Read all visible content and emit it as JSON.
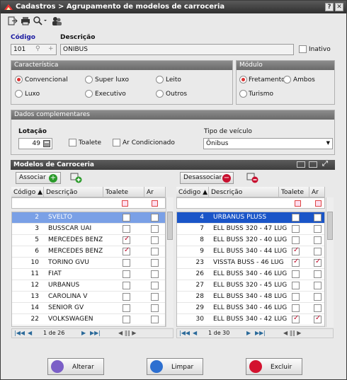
{
  "window": {
    "title": "Cadastros > Agrupamento de modelos de carroceria"
  },
  "form": {
    "codigo_label": "Código",
    "codigo_value": "101",
    "descricao_label": "Descrição",
    "descricao_value": "ONIBUS",
    "inativo_label": "Inativo"
  },
  "caracteristica": {
    "title": "Característica",
    "options": [
      "Convencional",
      "Super luxo",
      "Leito",
      "Luxo",
      "Executivo",
      "Outros"
    ],
    "selected": "Convencional"
  },
  "modulo": {
    "title": "Módulo",
    "options": [
      "Fretamento",
      "Ambos",
      "Turismo"
    ],
    "selected": "Fretamento"
  },
  "dados": {
    "title": "Dados complementares",
    "lotacao_label": "Lotação",
    "lotacao_value": "49",
    "toalete_label": "Toalete",
    "ar_label": "Ar Condicionado",
    "tipo_label": "Tipo de veículo",
    "tipo_value": "Ônibus"
  },
  "grid": {
    "title": "Modelos de Carroceria",
    "associar_label": "Associar",
    "desassociar_label": "Desassociar",
    "columns": {
      "codigo": "Código",
      "descricao": "Descrição",
      "toalete": "Toalete",
      "ar": "Ar"
    },
    "left_rows": [
      {
        "codigo": "2",
        "descricao": "SVELTO",
        "toalete": false,
        "ar": false
      },
      {
        "codigo": "3",
        "descricao": "BUSSCAR UAI",
        "toalete": false,
        "ar": false
      },
      {
        "codigo": "5",
        "descricao": "MERCEDES BENZ",
        "toalete": true,
        "ar": false
      },
      {
        "codigo": "6",
        "descricao": "MERCEDES BENZ",
        "toalete": true,
        "ar": false
      },
      {
        "codigo": "10",
        "descricao": "TORINO GVU",
        "toalete": false,
        "ar": false
      },
      {
        "codigo": "11",
        "descricao": "FIAT",
        "toalete": false,
        "ar": false
      },
      {
        "codigo": "12",
        "descricao": "URBANUS",
        "toalete": false,
        "ar": false
      },
      {
        "codigo": "13",
        "descricao": "CAROLINA V",
        "toalete": false,
        "ar": false
      },
      {
        "codigo": "14",
        "descricao": "SENIOR GV",
        "toalete": false,
        "ar": false
      },
      {
        "codigo": "22",
        "descricao": "VOLKSWAGEN",
        "toalete": false,
        "ar": false
      }
    ],
    "right_rows": [
      {
        "codigo": "4",
        "descricao": "URBANUS PLUSS",
        "toalete": false,
        "ar": false
      },
      {
        "codigo": "7",
        "descricao": "ELL BUSS 320 - 47 LUG",
        "toalete": false,
        "ar": false
      },
      {
        "codigo": "8",
        "descricao": "ELL BUSS 320 - 40 LUG",
        "toalete": false,
        "ar": false
      },
      {
        "codigo": "9",
        "descricao": "ELL BUSS 340 - 44 LUG",
        "toalete": true,
        "ar": false
      },
      {
        "codigo": "23",
        "descricao": "VISSTA BUSS - 46 LUG",
        "toalete": true,
        "ar": true
      },
      {
        "codigo": "26",
        "descricao": "ELL BUSS 340 - 46 LUG",
        "toalete": false,
        "ar": false
      },
      {
        "codigo": "27",
        "descricao": "ELL BUSS 320 - 45 LUG",
        "toalete": false,
        "ar": false
      },
      {
        "codigo": "28",
        "descricao": "ELL BUSS 340 - 48 LUG",
        "toalete": false,
        "ar": false
      },
      {
        "codigo": "29",
        "descricao": "ELL BUSS 340 - 46 LUG",
        "toalete": false,
        "ar": false
      },
      {
        "codigo": "30",
        "descricao": "ELL BUSS 340 - 42 LUG",
        "toalete": true,
        "ar": true
      }
    ],
    "left_pager": "1 de 26",
    "right_pager": "1 de 30"
  },
  "buttons": {
    "alterar": "Alterar",
    "limpar": "Limpar",
    "excluir": "Excluir"
  },
  "colors": {
    "selected_left": "#7aa0e6",
    "selected_right": "#1a55c8",
    "check": "#c0102f"
  }
}
